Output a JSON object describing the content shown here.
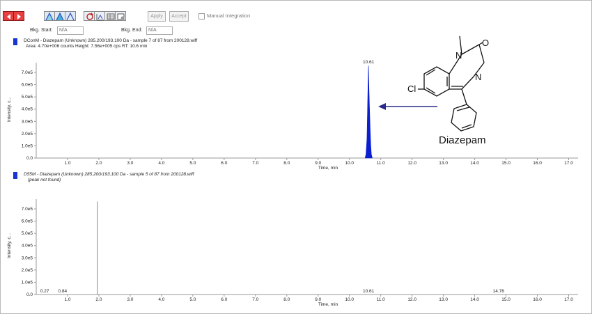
{
  "toolbar": {
    "apply_label": "Apply",
    "accept_label": "Accept",
    "manual_integration_label": "Manual Integration",
    "manual_integration_checked": false,
    "icons": [
      "prev-arrow-icon",
      "next-arrow-icon",
      "peak-icon-1",
      "peak-icon-2",
      "peak-icon-3",
      "reset-icon",
      "zoom-icon",
      "table-icon",
      "settings-icon"
    ]
  },
  "bkg": {
    "start_label": "Bkg. Start:",
    "start_value": "N/A",
    "end_label": "Bkg. End:",
    "end_value": "N/A"
  },
  "panel1": {
    "title": "DConM - Diazepam (Unknown) 285.200/193.100 Da - sample 7 of 87 from 200128.wiff",
    "subtitle": "Area: 4.70e+006 counts  Height: 7.56e+005 cps  RT: 10.6 min"
  },
  "panel2": {
    "title": "D55M - Diazepam (Unknown) 285.200/193.100 Da - sample 5 of 87 from 200128.wiff",
    "subtitle": "(peak not found)"
  },
  "molecule": {
    "name": "Diazepam",
    "atoms": {
      "n1": "N",
      "n4": "N",
      "o": "O",
      "cl": "Cl"
    }
  },
  "colors": {
    "trace": "#0a1fd0",
    "arrow": "#2a2a8a",
    "axis": "#999999"
  },
  "chart_data": [
    {
      "type": "line",
      "title": "DConM - Diazepam (Unknown) 285.200/193.100 Da - sample 7 of 87 from 200128.wiff",
      "xlabel": "Time, min",
      "ylabel": "Intensity, c...",
      "xlim": [
        0,
        17.3
      ],
      "ylim": [
        0,
        780000
      ],
      "x_ticks": [
        "1.0",
        "2.0",
        "3.0",
        "4.0",
        "5.0",
        "6.0",
        "7.0",
        "8.0",
        "9.0",
        "10.0",
        "11.0",
        "12.0",
        "13.0",
        "14.0",
        "15.0",
        "16.0",
        "17.0"
      ],
      "y_ticks": [
        "0.0",
        "1.0e5",
        "2.0e5",
        "3.0e5",
        "4.0e5",
        "5.0e5",
        "6.0e5",
        "7.0e5"
      ],
      "peaks": [
        {
          "label": "10.61",
          "x": [
            10.5,
            10.53,
            10.56,
            10.58,
            10.6,
            10.61,
            10.62,
            10.64,
            10.66,
            10.68,
            10.7,
            10.73
          ],
          "y": [
            0,
            30000,
            160000,
            420000,
            690000,
            756000,
            600000,
            420000,
            250000,
            110000,
            30000,
            0
          ]
        }
      ]
    },
    {
      "type": "line",
      "title": "D55M - Diazepam (Unknown) 285.200/193.100 Da - sample 5 of 87 from 200128.wiff",
      "xlabel": "Time, min",
      "ylabel": "Intensity, c...",
      "xlim": [
        0,
        17.3
      ],
      "ylim": [
        0,
        780000
      ],
      "x_ticks": [
        "1.0",
        "2.0",
        "3.0",
        "4.0",
        "5.0",
        "6.0",
        "7.0",
        "8.0",
        "9.0",
        "10.0",
        "11.0",
        "12.0",
        "13.0",
        "14.0",
        "15.0",
        "16.0",
        "17.0"
      ],
      "y_ticks": [
        "0.0",
        "1.0e5",
        "2.0e5",
        "3.0e5",
        "4.0e5",
        "5.0e5",
        "6.0e5",
        "7.0e5"
      ],
      "annotations": [
        {
          "label": "0.27",
          "x": 0.27
        },
        {
          "label": "0.84",
          "x": 0.84
        },
        {
          "label": "10.61",
          "x": 10.61
        },
        {
          "label": "14.76",
          "x": 14.76
        }
      ],
      "markers": [
        {
          "x": 1.95,
          "y": 760000
        }
      ]
    }
  ]
}
